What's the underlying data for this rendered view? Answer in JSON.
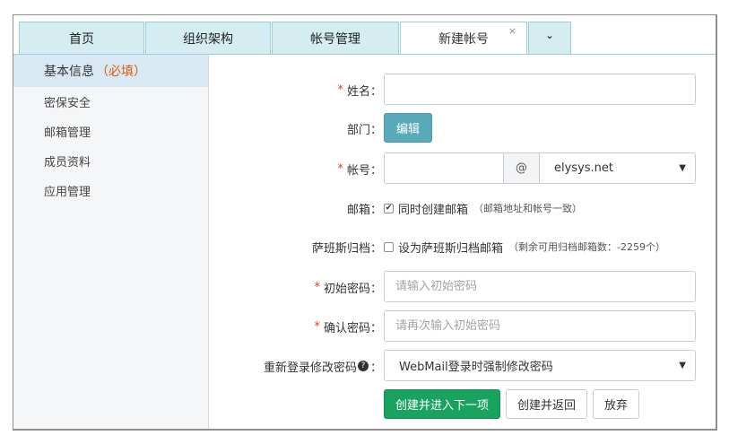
{
  "tabs": [
    {
      "label": "首页"
    },
    {
      "label": "组织架构"
    },
    {
      "label": "帐号管理"
    },
    {
      "label": "新建帐号",
      "close": "×"
    }
  ],
  "tab_dropdown": "⌄",
  "sidebar": {
    "items": [
      {
        "label": "基本信息",
        "required": "（必填）"
      },
      {
        "label": "密保安全"
      },
      {
        "label": "邮箱管理"
      },
      {
        "label": "成员资料"
      },
      {
        "label": "应用管理"
      }
    ]
  },
  "form": {
    "required_mark": "*",
    "name": {
      "label": "姓名：",
      "value": ""
    },
    "dept": {
      "label": "部门：",
      "button": "编辑"
    },
    "account": {
      "label": "帐号：",
      "value": "",
      "at": "@",
      "domain": "elysys.net"
    },
    "mailbox": {
      "label": "邮箱：",
      "checkbox_label": "同时创建邮箱",
      "hint": "（邮箱地址和帐号一致）",
      "checked": true
    },
    "archive": {
      "label": "萨班斯归档：",
      "checkbox_label": "设为萨班斯归档邮箱",
      "hint": "（剩余可用归档邮箱数：-2259个）",
      "checked": false
    },
    "password": {
      "label": "初始密码：",
      "placeholder": "请输入初始密码"
    },
    "confirm": {
      "label": "确认密码：",
      "placeholder": "请再次输入初始密码"
    },
    "relogin": {
      "label": "重新登录修改密码",
      "help": "?",
      "colon": "：",
      "value": "WebMail登录时强制修改密码"
    }
  },
  "buttons": {
    "create_next": "创建并进入下一项",
    "create_back": "创建并返回",
    "discard": "放弃"
  },
  "colors": {
    "tab_bg": "#d5ecf1",
    "required": "#e0392b",
    "primary": "#1aa260",
    "edit": "#5aaab9"
  }
}
